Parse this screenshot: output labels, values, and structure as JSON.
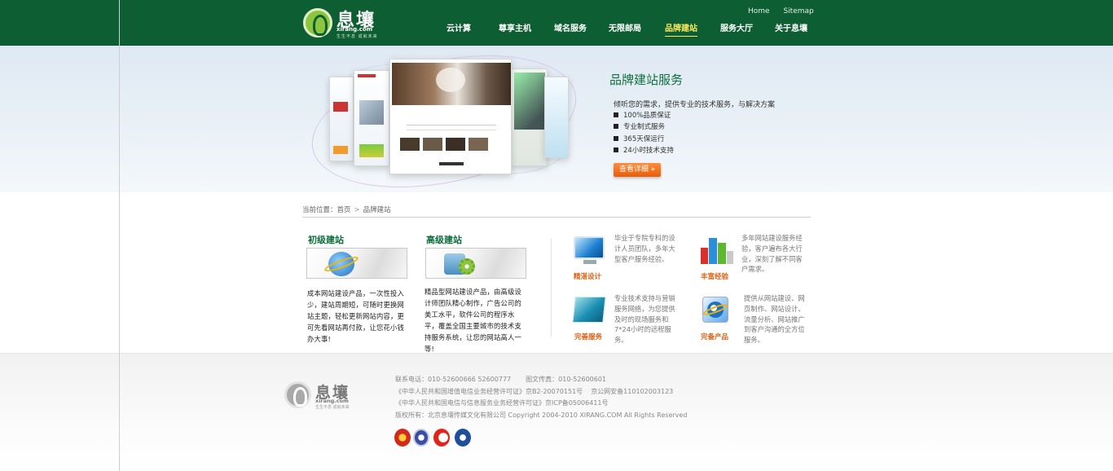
{
  "header": {
    "logo_cn": "息壤",
    "logo_en": "xirang.com",
    "logo_slogan": "生生不息 成就未来",
    "top_links": [
      "Home",
      "Sitemap"
    ],
    "nav": [
      {
        "label": "云计算",
        "active": false
      },
      {
        "label": "尊享主机",
        "active": false
      },
      {
        "label": "域名服务",
        "active": false
      },
      {
        "label": "无限邮局",
        "active": false
      },
      {
        "label": "品牌建站",
        "active": true
      },
      {
        "label": "服务大厅",
        "active": false
      },
      {
        "label": "关于息壤",
        "active": false
      }
    ]
  },
  "banner": {
    "title": "品牌建站服务",
    "intro": "倾听您的需求，提供专业的技术服务，与解决方案",
    "bullets": [
      "100%品质保证",
      "专业制式服务",
      "365天保运行",
      "24小时技术支持"
    ],
    "button": "查看详细 »"
  },
  "breadcrumb": {
    "prefix": "当前位置：",
    "home": "首页",
    "separator": ">",
    "current": "品牌建站"
  },
  "products": [
    {
      "title": "初级建站",
      "icon": "ie-icon",
      "desc": "成本网站建设产品，一次性投入少，建站周期短，可随时更换网站主题，轻松更新网站内容，更可先看网站再付款，让您花小钱办大事!"
    },
    {
      "title": "高级建站",
      "icon": "gears-icon",
      "desc": "精品型网站建设产品，由高级设计师团队精心制作，广告公司的美工水平，软件公司的程序水平，覆盖全国主要城市的技术支持服务系统，让您的网站高人一等!"
    }
  ],
  "features": [
    {
      "label": "精湛设计",
      "icon": "monitor-icon",
      "desc": "毕业于专院专科的设计人员团队，多年大型客户服务经验。"
    },
    {
      "label": "丰富经验",
      "icon": "bar-chart-icon",
      "desc": "多年网站建设服务经验，客户遍布各大行业，深刻了解不同客户需求。"
    },
    {
      "label": "完善服务",
      "icon": "map-icon",
      "desc": "专业技术支持与营销服务网络，为您提供及时的现场服务和7*24小时的远程服务。"
    },
    {
      "label": "完备产品",
      "icon": "ie-icon",
      "desc": "提供从网站建设、网页制作、网站设计、流量分析、网站推广到客户沟通的全方位服务。"
    }
  ],
  "footer": {
    "logo_cn": "息壤",
    "logo_en": "xirang.com",
    "logo_slogan": "生生不息 成就未来",
    "phone": "联系电话：010-52600666 52600777",
    "fax": "图文传真：010-52600601",
    "license1a": "《中华人民共和国增值电信业务经营许可证》京B2-20070151号",
    "license1b": "京公网安备110102003123",
    "license2": "《中华人民共和国电信与信息服务业务经营许可证》京ICP备05006411号",
    "copyright": "版权所有：北京息壤传媒文化有限公司 Copyright 2004-2010 XIRANG.COM All Rights Reserved"
  },
  "colors": {
    "brand_green": "#0d5f33",
    "accent_orange": "#e35f10",
    "nav_active": "#ffe85a"
  }
}
